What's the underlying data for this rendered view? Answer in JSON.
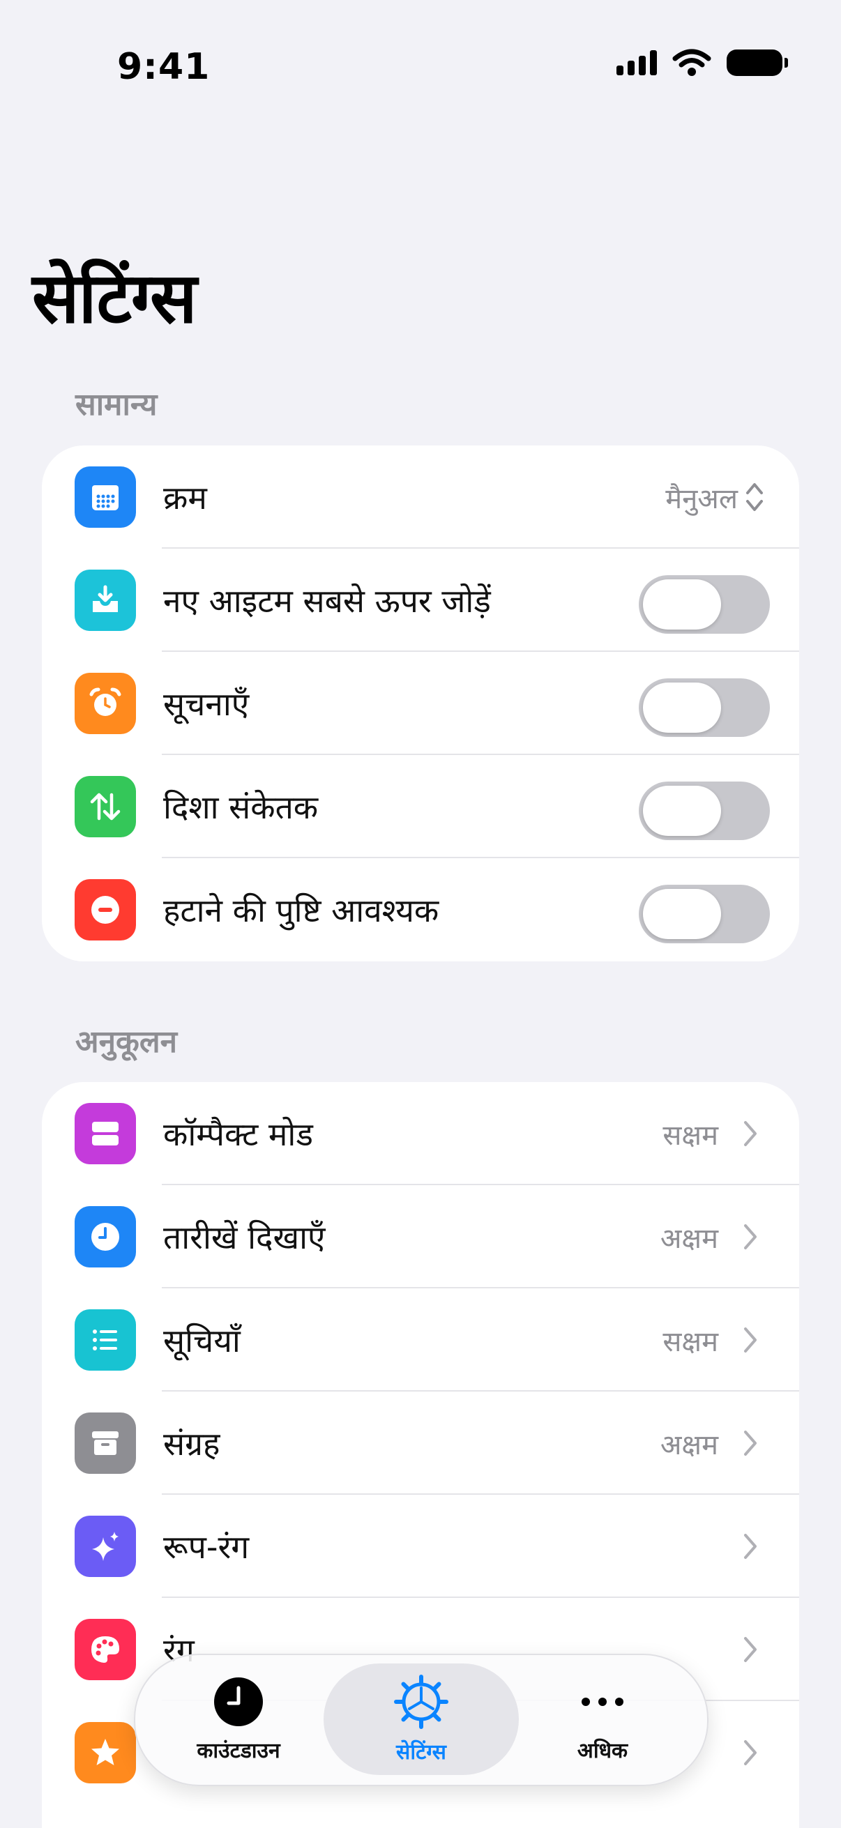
{
  "status": {
    "time": "9:41"
  },
  "title": "सेटिंग्स",
  "sections": {
    "general": {
      "title": "सामान्य",
      "rows": {
        "order": {
          "label": "क्रम",
          "value": "मैनुअल",
          "icon": "calendar-grid-icon",
          "color": "#1E86F6"
        },
        "add_top": {
          "label": "नए आइटम सबसे ऊपर जोड़ें",
          "toggle": false,
          "icon": "tray-download-icon",
          "color": "#1CC3D9"
        },
        "notifications": {
          "label": "सूचनाएँ",
          "toggle": false,
          "icon": "alarm-clock-icon",
          "color": "#FF8A1E"
        },
        "direction": {
          "label": "दिशा संकेतक",
          "toggle": false,
          "icon": "up-down-arrows-icon",
          "color": "#34C759"
        },
        "confirm_delete": {
          "label": "हटाने की पुष्टि आवश्यक",
          "toggle": false,
          "icon": "minus-circle-icon",
          "color": "#FF3B30"
        }
      }
    },
    "custom": {
      "title": "अनुकूलन",
      "rows": {
        "compact": {
          "label": "कॉम्पैक्ट मोड",
          "value": "सक्षम",
          "icon": "stacked-rows-icon",
          "color": "#C43BDB"
        },
        "dates": {
          "label": "तारीखें दिखाएँ",
          "value": "अक्षम",
          "icon": "clock-icon",
          "color": "#1E86F6"
        },
        "lists": {
          "label": "सूचियाँ",
          "value": "सक्षम",
          "icon": "list-icon",
          "color": "#18C3D2"
        },
        "archive": {
          "label": "संग्रह",
          "value": "अक्षम",
          "icon": "archive-box-icon",
          "color": "#8E8E93"
        },
        "appearance": {
          "label": "रूप-रंग",
          "icon": "sparkles-icon",
          "color": "#6B5CF5"
        },
        "color": {
          "label": "रंग",
          "icon": "palette-icon",
          "color": "#FF2D55"
        },
        "featured": {
          "label": "",
          "icon": "star-icon",
          "color": "#FF8A1E"
        }
      }
    }
  },
  "tabs": {
    "countdown": {
      "label": "काउंटडाउन",
      "icon": "clock-icon"
    },
    "settings": {
      "label": "सेटिंग्स",
      "icon": "gear-icon",
      "active": true
    },
    "more": {
      "label": "अधिक",
      "icon": "ellipsis-icon"
    }
  }
}
